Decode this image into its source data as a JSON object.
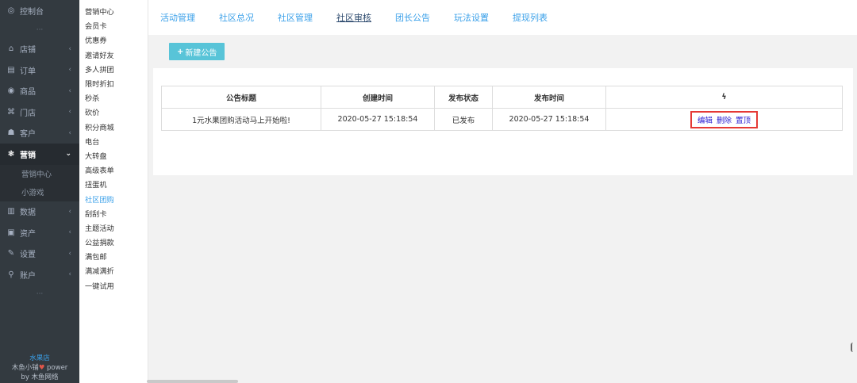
{
  "left_nav": {
    "items": [
      {
        "icon": "◎",
        "label": "控制台",
        "chevron": ""
      },
      {
        "icon": "⌂",
        "label": "店铺",
        "chevron": "‹"
      },
      {
        "icon": "▤",
        "label": "订单",
        "chevron": "‹"
      },
      {
        "icon": "◉",
        "label": "商品",
        "chevron": "‹"
      },
      {
        "icon": "⌘",
        "label": "门店",
        "chevron": "‹"
      },
      {
        "icon": "☗",
        "label": "客户",
        "chevron": "‹"
      },
      {
        "icon": "❃",
        "label": "营销",
        "chevron": "⌄"
      },
      {
        "icon": "▥",
        "label": "数据",
        "chevron": "‹"
      },
      {
        "icon": "▣",
        "label": "资产",
        "chevron": "‹"
      },
      {
        "icon": "✎",
        "label": "设置",
        "chevron": "‹"
      },
      {
        "icon": "⚲",
        "label": "账户",
        "chevron": "‹"
      }
    ],
    "sub_items": [
      "营销中心",
      "小游戏"
    ],
    "dots": "···",
    "brand": {
      "shop": "水果店",
      "line1_a": "木鱼小铺",
      "heart": "♥",
      "line1_b": "power",
      "line2": "by 木鱼网络"
    }
  },
  "sub_nav": {
    "items": [
      "营销中心",
      "会员卡",
      "优惠券",
      "邀请好友",
      "多人拼团",
      "限时折扣",
      "秒杀",
      "砍价",
      "积分商城",
      "电台",
      "大转盘",
      "高级表单",
      "扭蛋机",
      "社区团购",
      "刮刮卡",
      "主题活动",
      "公益捐款",
      "满包邮",
      "满减满折",
      "一键试用"
    ]
  },
  "tabs": [
    "活动管理",
    "社区总况",
    "社区管理",
    "社区审核",
    "团长公告",
    "玩法设置",
    "提现列表"
  ],
  "toolbar": {
    "new_button": "新建公告",
    "plus": "+"
  },
  "table": {
    "headers": [
      "公告标题",
      "创建时间",
      "发布状态",
      "发布时间",
      "ϟ"
    ],
    "rows": [
      {
        "title": "1元水果团购活动马上开始啦!",
        "created": "2020-05-27 15:18:54",
        "status": "已发布",
        "published": "2020-05-27 15:18:54",
        "actions": [
          "编辑",
          "删除",
          "置顶"
        ]
      }
    ]
  }
}
